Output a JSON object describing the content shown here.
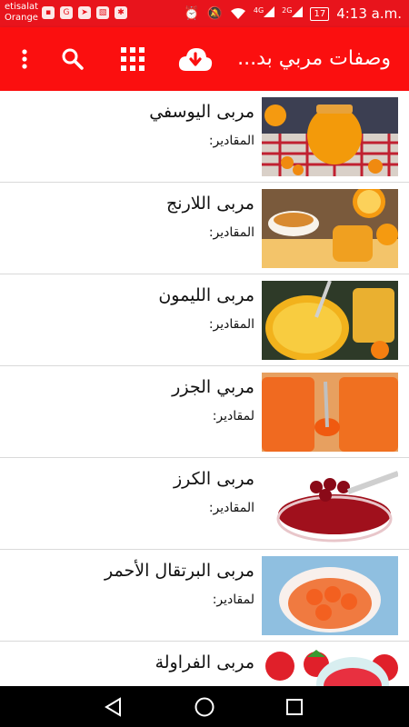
{
  "status_bar": {
    "carrier_line1": "etisalat",
    "carrier_line2": "Orange",
    "network_4g": "4G",
    "network_2g": "2G",
    "battery": "17",
    "time": "4:13 a.m."
  },
  "app_bar": {
    "title": "وصفات مربي بد...",
    "icons": [
      "more-vert-icon",
      "search-icon",
      "apps-grid-icon",
      "cloud-download-icon"
    ]
  },
  "recipes": [
    {
      "title": "مربى اليوسفي",
      "subtitle": "المقادير:",
      "image": "tangerine-jam-photo"
    },
    {
      "title": "مربى اللارنج",
      "subtitle": "المقادير:",
      "image": "bitter-orange-jam-photo"
    },
    {
      "title": "مربى الليمون",
      "subtitle": "المقادير:",
      "image": "lemon-jam-photo"
    },
    {
      "title": "مربي الجزر",
      "subtitle": "لمقادير:",
      "image": "carrot-jam-photo"
    },
    {
      "title": "مربى الكرز",
      "subtitle": "المقادير:",
      "image": "cherry-jam-photo"
    },
    {
      "title": "مربى البرتقال الأحمر",
      "subtitle": "لمقادير:",
      "image": "blood-orange-jam-photo"
    },
    {
      "title": "مربى الفراولة",
      "subtitle": "",
      "image": "strawberry-jam-photo"
    }
  ],
  "colors": {
    "primary": "#fb0f0f",
    "status_bar": "#e8141c",
    "divider": "#d9d9d9"
  }
}
